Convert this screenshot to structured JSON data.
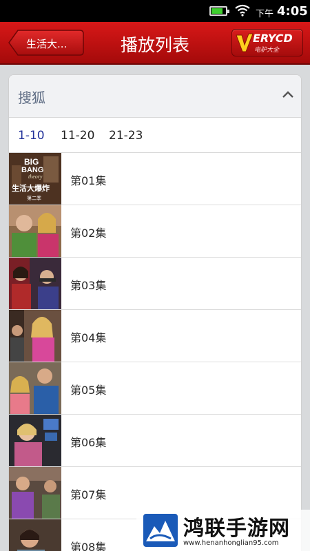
{
  "status_bar": {
    "period": "下午",
    "time": "4:05",
    "battery_level": 0.8,
    "battery_color": "#3fcf2f"
  },
  "title_bar": {
    "back_label": "生活大...",
    "title": "播放列表",
    "brand_name": "ERYCD",
    "brand_sub": "电驴大全",
    "accent_color": "#c4121a"
  },
  "source": {
    "name": "搜狐",
    "ranges": [
      "1-10",
      "11-20",
      "21-23"
    ],
    "active_range": "1-10"
  },
  "episodes": [
    {
      "label": "第01集",
      "thumb": "poster-thumbnail"
    },
    {
      "label": "第02集",
      "thumb": "scene-thumbnail"
    },
    {
      "label": "第03集",
      "thumb": "scene-thumbnail"
    },
    {
      "label": "第04集",
      "thumb": "scene-thumbnail"
    },
    {
      "label": "第05集",
      "thumb": "scene-thumbnail"
    },
    {
      "label": "第06集",
      "thumb": "scene-thumbnail"
    },
    {
      "label": "第07集",
      "thumb": "scene-thumbnail"
    },
    {
      "label": "第08集",
      "thumb": "scene-thumbnail"
    }
  ],
  "poster": {
    "line1": "BIG",
    "line2": "BANG",
    "line3": "theory",
    "cn_title": "生活大爆炸",
    "season": "第二季"
  },
  "watermark": {
    "title": "鸿联手游网",
    "url": "www.henanhonglian95.com"
  }
}
